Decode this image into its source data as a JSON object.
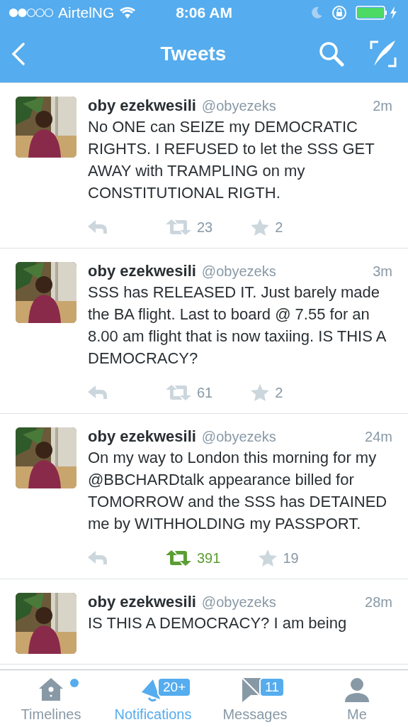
{
  "status_bar": {
    "carrier": "AirtelNG",
    "time": "8:06 AM"
  },
  "nav": {
    "title": "Tweets"
  },
  "tweets": [
    {
      "name": "oby ezekwesili",
      "handle": "@obyezeks",
      "time": "2m",
      "text": "No ONE can SEIZE my DEMOCRATIC RIGHTS. I REFUSED to let the SSS GET AWAY with TRAMPLING on my CONSTITUTIONAL RIGTH.",
      "retweets": "23",
      "retweeted": false,
      "favorites": "2"
    },
    {
      "name": "oby ezekwesili",
      "handle": "@obyezeks",
      "time": "3m",
      "text": "SSS has RELEASED IT. Just barely made the BA flight. Last to board @ 7.55 for an 8.00 am flight that is now taxiing. IS THIS A DEMOCRACY?",
      "retweets": "61",
      "retweeted": false,
      "favorites": "2"
    },
    {
      "name": "oby ezekwesili",
      "handle": "@obyezeks",
      "time": "24m",
      "text": "On my way to London this morning for my @BBCHARDtalk appearance billed for TOMORROW and the SSS has DETAINED me by WITHHOLDING my PASSPORT.",
      "retweets": "391",
      "retweeted": true,
      "favorites": "19"
    },
    {
      "name": "oby ezekwesili",
      "handle": "@obyezeks",
      "time": "28m",
      "text": "IS THIS A DEMOCRACY? I am being"
    }
  ],
  "tab_bar": [
    {
      "kind": "home",
      "label": "Timelines",
      "selected": false,
      "unread_dot": true
    },
    {
      "kind": "notifications",
      "label": "Notifications",
      "selected": true,
      "badge": "20+"
    },
    {
      "kind": "messages",
      "label": "Messages",
      "selected": false,
      "badge": "11"
    },
    {
      "kind": "me",
      "label": "Me",
      "selected": false
    }
  ]
}
